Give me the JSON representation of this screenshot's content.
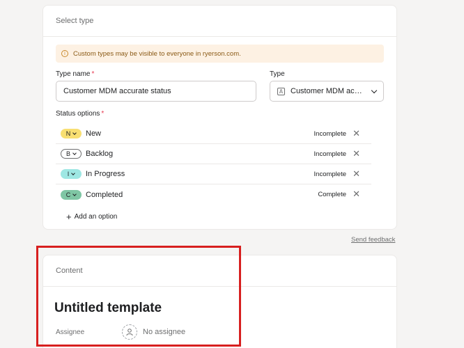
{
  "select_card": {
    "header": "Select type",
    "notice": "Custom types may be visible to everyone in ryerson.com.",
    "type_name_label": "Type name",
    "type_name_value": "Customer MDM accurate status",
    "type_label": "Type",
    "type_value": "Customer MDM accurate status",
    "type_glyph": "A",
    "status_options_label": "Status options",
    "required_mark": "*",
    "statuses": [
      {
        "letter": "N",
        "name": "New",
        "state": "Incomplete",
        "color": "#f8df72"
      },
      {
        "letter": "B",
        "name": "Backlog",
        "state": "Incomplete",
        "color": "#ffffff"
      },
      {
        "letter": "I",
        "name": "In Progress",
        "state": "Incomplete",
        "color": "#9ee7e3"
      },
      {
        "letter": "C",
        "name": "Completed",
        "state": "Complete",
        "color": "#7fc6a4"
      }
    ],
    "remove_glyph": "✕",
    "add_option": "Add an option"
  },
  "feedback_link": "Send feedback",
  "content_card": {
    "header": "Content",
    "title": "Untitled template",
    "assignee_label": "Assignee",
    "assignee_value": "No assignee"
  },
  "colors": {
    "highlight": "#d71f1f",
    "notice_bg": "#fdf1e3",
    "required": "#e8384f"
  }
}
